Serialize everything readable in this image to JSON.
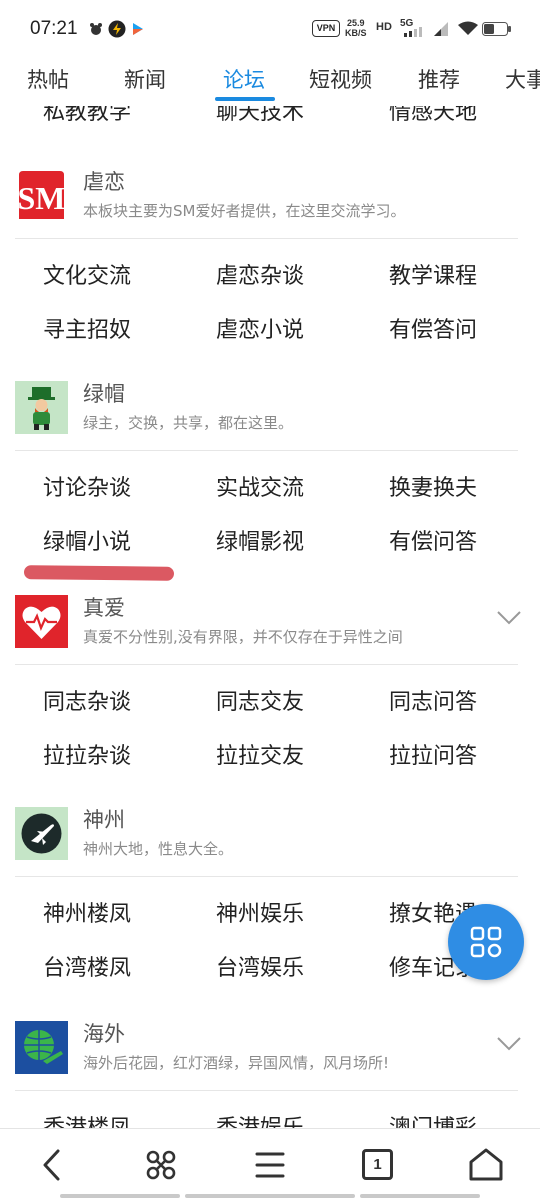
{
  "status_bar": {
    "time": "07:21",
    "vpn_label": "VPN",
    "net_speed_value": "25.9",
    "net_speed_unit": "KB/S",
    "hd_label": "HD",
    "network_label": "5G"
  },
  "tabs": [
    {
      "label": "热帖"
    },
    {
      "label": "新闻"
    },
    {
      "label": "论坛"
    },
    {
      "label": "短视频"
    },
    {
      "label": "推荐"
    },
    {
      "label": "大事"
    }
  ],
  "active_tab": "论坛",
  "cutoff_row": [
    "私教教学",
    "聊天技术",
    "情感天地"
  ],
  "sections": [
    {
      "title": "虐恋",
      "logo_text": "SM",
      "desc": "本板块主要为SM爱好者提供，在这里交流学习。",
      "items": [
        "文化交流",
        "虐恋杂谈",
        "教学课程",
        "寻主招奴",
        "虐恋小说",
        "有偿答问"
      ]
    },
    {
      "title": "绿帽",
      "desc": "绿主，交换，共享，都在这里。",
      "items": [
        "讨论杂谈",
        "实战交流",
        "换妻换夫",
        "绿帽小说",
        "绿帽影视",
        "有偿问答"
      ]
    },
    {
      "title": "真爱",
      "desc": "真爱不分性别,没有界限，并不仅存在于异性之间",
      "items": [
        "同志杂谈",
        "同志交友",
        "同志问答",
        "拉拉杂谈",
        "拉拉交友",
        "拉拉问答"
      ]
    },
    {
      "title": "神州",
      "desc": "神州大地，性息大全。",
      "items": [
        "神州楼凤",
        "神州娱乐",
        "撩女艳遇",
        "台湾楼凤",
        "台湾娱乐",
        "修车记录"
      ]
    },
    {
      "title": "海外",
      "desc": "海外后花园，红灯酒绿，异国风情，风月场所!",
      "items": [
        "香港楼凤",
        "香港娱乐",
        "澳门博彩"
      ]
    }
  ],
  "colors": {
    "accent": "#1a8ae0",
    "fab": "#2f8de4",
    "highlight_stroke": "#d9505a",
    "sm_logo": "#e0242b",
    "heart_logo": "#e0242b",
    "leprechaun_bg": "#c5e5c7",
    "plane_bg": "#c5e5c7",
    "overseas_bg": "#1c4fa0"
  },
  "icons": [
    "back-icon",
    "command-icon",
    "menu-icon",
    "tabs-count-icon",
    "home-icon",
    "grid-icon",
    "chevron-down-icon"
  ],
  "bottom_nav": {
    "tab_count": "1"
  }
}
